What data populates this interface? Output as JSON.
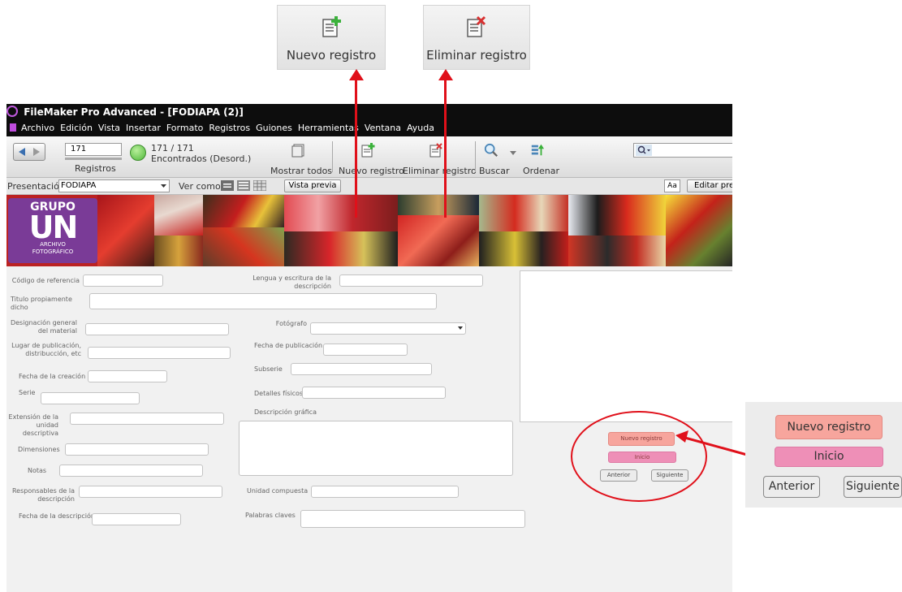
{
  "callouts": {
    "new_record": "Nuevo registro",
    "delete_record": "Eliminar registro"
  },
  "window": {
    "title": "FileMaker Pro Advanced - [FODIAPA (2)]"
  },
  "menu": [
    "Archivo",
    "Edición",
    "Vista",
    "Insertar",
    "Formato",
    "Registros",
    "Guiones",
    "Herramientas",
    "Ventana",
    "Ayuda"
  ],
  "toolbar": {
    "record_number": "171",
    "records_label": "Registros",
    "found_count": "171 / 171",
    "found_status": "Encontrados (Desord.)",
    "show_all": "Mostrar todos",
    "new_record": "Nuevo registro",
    "delete_record": "Eliminar registro",
    "find": "Buscar",
    "sort": "Ordenar",
    "search_placeholder": ""
  },
  "layoutbar": {
    "presentation_label": "Presentación:",
    "presentation_value": "FODIAPA",
    "view_as": "Ver como:",
    "preview": "Vista previa",
    "font_toggle": "Aa",
    "edit_layout": "Editar pre"
  },
  "logo": {
    "line1": "GRUPO",
    "line2": "UN",
    "line3": "ARCHIVO",
    "line4": "FOTOGRÁFICO"
  },
  "form": {
    "codigo_referencia": "Código de referencia",
    "lengua_escritura": "Lengua y escritura de la descripción",
    "titulo": "Titulo propiamente dicho",
    "designacion": "Designación general del material",
    "fotografo": "Fotógrafo",
    "lugar_publicacion": "Lugar de publicación, distribucción, etc",
    "fecha_publicacion": "Fecha de publicación",
    "fecha_creacion": "Fecha de la creación",
    "subserie": "Subserie",
    "serie": "Serie",
    "detalles_fisicos": "Detalles físicos",
    "extension": "Extensión de la unidad descriptiva",
    "descripcion_grafica": "Descripción gráfica",
    "dimensiones": "Dimensiones",
    "notas": "Notas",
    "responsables": "Responsables de la descripción",
    "unidad_compuesta": "Unidad compuesta",
    "fecha_descripcion": "Fecha de la descripción",
    "palabras_claves": "Palabras claves"
  },
  "buttons": {
    "nuevo_registro": "Nuevo registro",
    "inicio": "Inicio",
    "anterior": "Anterior",
    "siguiente": "Siguiente"
  },
  "colors": {
    "accent_red": "#e0101a",
    "new_button": "#f7a59d",
    "home_button": "#ee8fb7",
    "logo_purple": "#7a3b97"
  }
}
